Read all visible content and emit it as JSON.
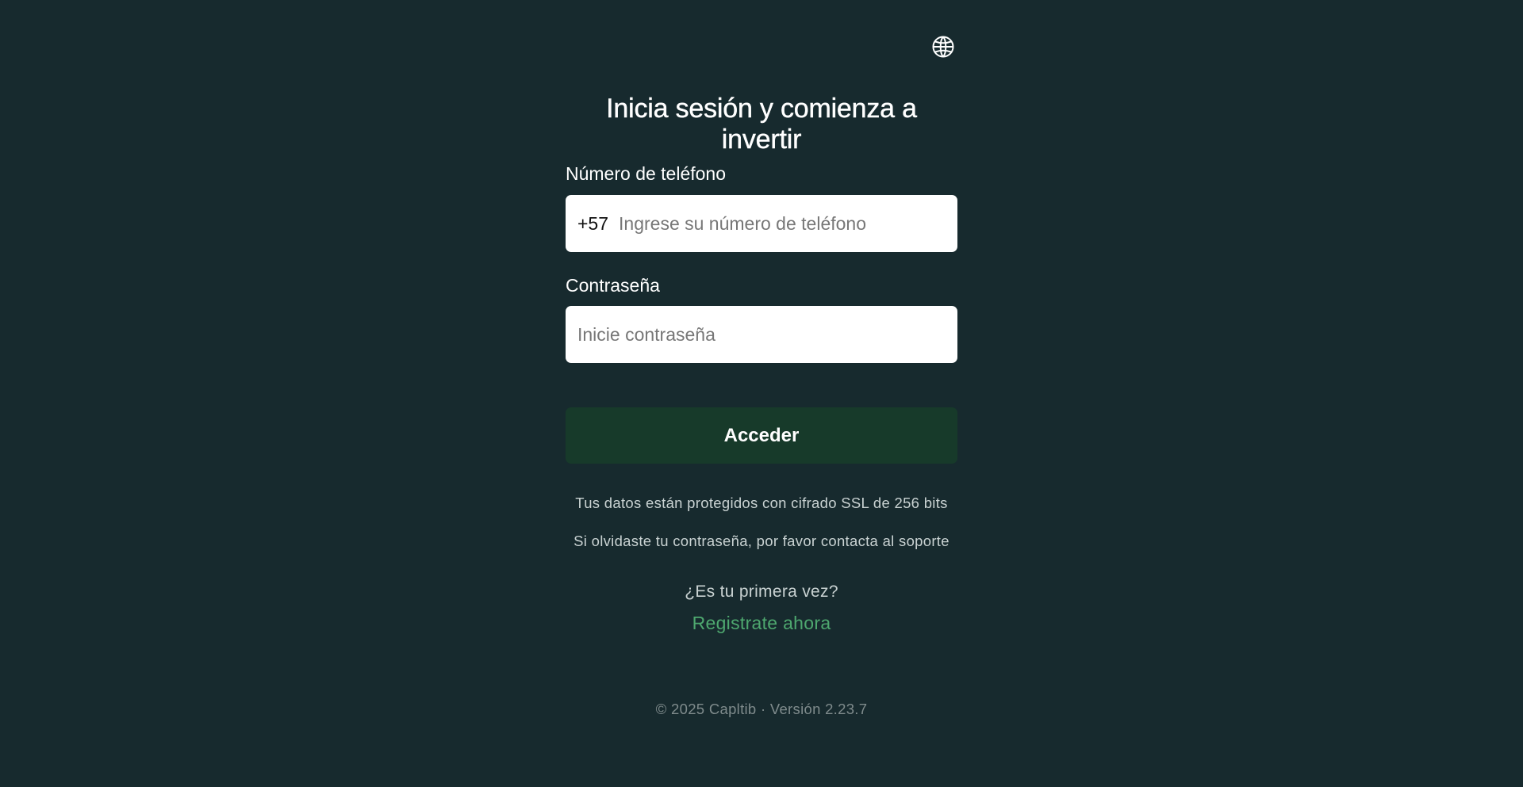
{
  "header": {
    "language_icon": "globe-icon"
  },
  "login": {
    "title": "Inicia sesión y comienza a invertir",
    "phone_label": "Número de teléfono",
    "phone_prefix": "+57",
    "phone_placeholder": "Ingrese su número de teléfono",
    "phone_value": "",
    "password_label": "Contraseña",
    "password_placeholder": "Inicie contraseña",
    "password_value": "",
    "submit_label": "Acceder",
    "ssl_note": "Tus datos están protegidos con cifrado SSL de 256 bits",
    "forgot_note": "Si olvidaste tu contraseña, por favor contacta al soporte",
    "first_time_text": "¿Es tu primera vez?",
    "register_link": "Registrate ahora"
  },
  "footer": {
    "text": "© 2025 Capltib · Versión 2.23.7"
  },
  "colors": {
    "background": "#172a2e",
    "button_background": "#173a2a",
    "link": "#4ea86f"
  }
}
